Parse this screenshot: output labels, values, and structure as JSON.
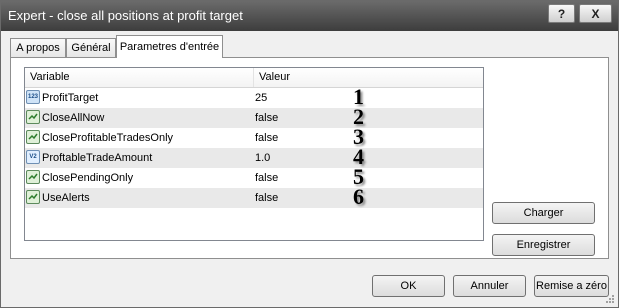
{
  "window": {
    "title": "Expert - close all positions at profit target"
  },
  "caption_buttons": {
    "help": "?",
    "close": "X"
  },
  "tabs": [
    {
      "label": "A propos"
    },
    {
      "label": "Général"
    },
    {
      "label": "Parametres d'entrée"
    }
  ],
  "active_tab": "Parametres d'entrée",
  "grid": {
    "columns": [
      "Variable",
      "Valeur"
    ],
    "rows": [
      {
        "icon": "integer-icon",
        "icon_text": "123",
        "variable": "ProfitTarget",
        "value": "25",
        "annotation": "1"
      },
      {
        "icon": "boolean-icon",
        "icon_text": "",
        "variable": "CloseAllNow",
        "value": "false",
        "annotation": "2"
      },
      {
        "icon": "boolean-icon",
        "icon_text": "",
        "variable": "CloseProfitableTradesOnly",
        "value": "false",
        "annotation": "3"
      },
      {
        "icon": "double-icon",
        "icon_text": "V2",
        "variable": "ProftableTradeAmount",
        "value": "1.0",
        "annotation": "4"
      },
      {
        "icon": "boolean-icon",
        "icon_text": "",
        "variable": "ClosePendingOnly",
        "value": "false",
        "annotation": "5"
      },
      {
        "icon": "boolean-icon",
        "icon_text": "",
        "variable": "UseAlerts",
        "value": "false",
        "annotation": "6"
      }
    ]
  },
  "side_buttons": {
    "load": "Charger",
    "save": "Enregistrer"
  },
  "footer_buttons": {
    "ok": "OK",
    "cancel": "Annuler",
    "reset": "Remise a zéro"
  }
}
